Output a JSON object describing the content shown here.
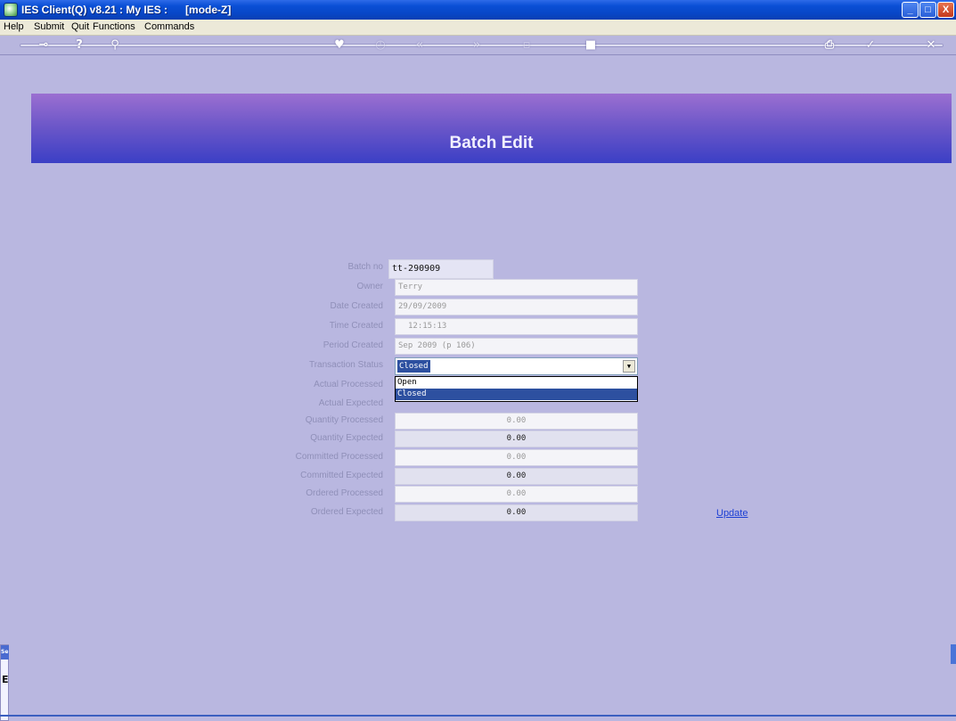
{
  "window": {
    "title": "IES Client(Q) v8.21 : My IES :      [mode-Z]",
    "controls": {
      "minimize": "_",
      "maximize": "□",
      "close": "X"
    }
  },
  "menu": [
    "Help",
    "Submit",
    "Quit",
    "Functions",
    "Commands"
  ],
  "toolbar": {
    "icons": [
      "key-icon",
      "help-icon",
      "search-icon",
      "heart-icon",
      "clock-icon",
      "back-icon",
      "forward-icon",
      "page-icon",
      "stop-icon",
      "print-icon",
      "ok-icon",
      "close-icon"
    ]
  },
  "page": {
    "title": "Batch Edit"
  },
  "form": {
    "batch_no": {
      "label": "Batch no",
      "value": "tt-290909"
    },
    "owner": {
      "label": "Owner",
      "value": "Terry"
    },
    "date_created": {
      "label": "Date Created",
      "value": "29/09/2009"
    },
    "time_created": {
      "label": "Time Created",
      "value": "12:15:13"
    },
    "period_created": {
      "label": "Period Created",
      "value": "Sep 2009 (p 106)"
    },
    "transaction_status": {
      "label": "Transaction Status",
      "selected": "Closed",
      "options": [
        "Open",
        "Closed"
      ]
    },
    "actual_processed": {
      "label": "Actual Processed"
    },
    "actual_expected": {
      "label": "Actual Expected"
    },
    "quantity_processed": {
      "label": "Quantity Processed",
      "value": "0.00"
    },
    "quantity_expected": {
      "label": "Quantity Expected",
      "value": "0.00"
    },
    "committed_processed": {
      "label": "Committed Processed",
      "value": "0.00"
    },
    "committed_expected": {
      "label": "Committed Expected",
      "value": "0.00"
    },
    "ordered_processed": {
      "label": "Ordered Processed",
      "value": "0.00"
    },
    "ordered_expected": {
      "label": "Ordered Expected",
      "value": "0.00"
    }
  },
  "actions": {
    "update": "Update"
  },
  "sidetab": {
    "top": "Se",
    "char": "E"
  }
}
